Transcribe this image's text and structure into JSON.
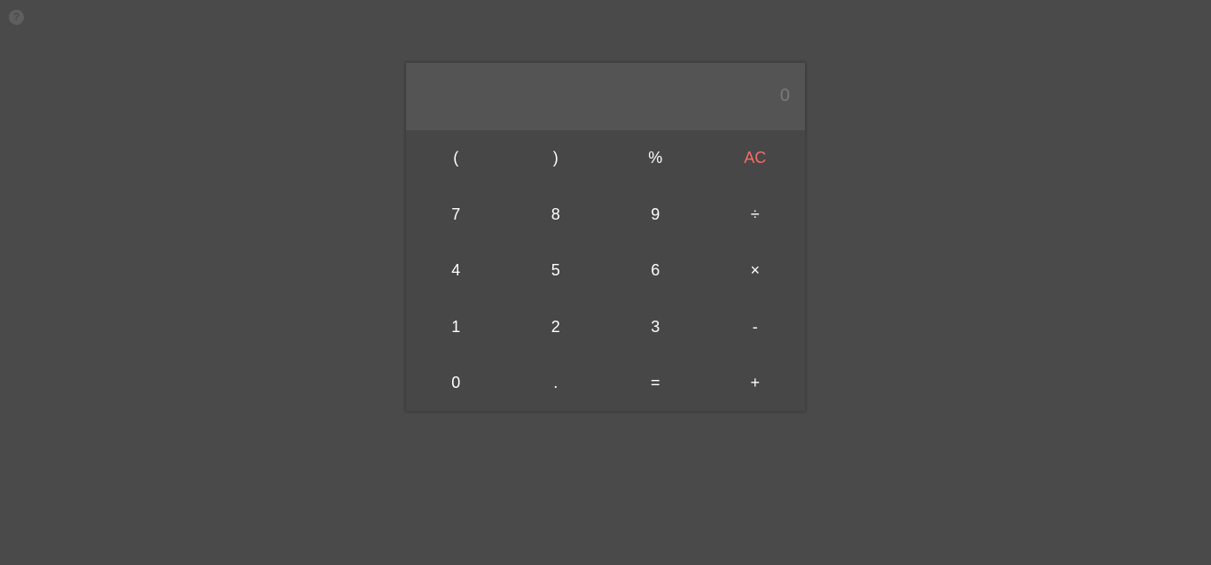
{
  "help": {
    "icon": "question-circle-icon",
    "glyph": "?"
  },
  "display": {
    "value": "0"
  },
  "keys": [
    {
      "label": "(",
      "name": "open-paren-button"
    },
    {
      "label": ")",
      "name": "close-paren-button"
    },
    {
      "label": "%",
      "name": "percent-button"
    },
    {
      "label": "AC",
      "name": "all-clear-button"
    },
    {
      "label": "7",
      "name": "digit-7-button"
    },
    {
      "label": "8",
      "name": "digit-8-button"
    },
    {
      "label": "9",
      "name": "digit-9-button"
    },
    {
      "label": "÷",
      "name": "divide-button"
    },
    {
      "label": "4",
      "name": "digit-4-button"
    },
    {
      "label": "5",
      "name": "digit-5-button"
    },
    {
      "label": "6",
      "name": "digit-6-button"
    },
    {
      "label": "×",
      "name": "multiply-button"
    },
    {
      "label": "1",
      "name": "digit-1-button"
    },
    {
      "label": "2",
      "name": "digit-2-button"
    },
    {
      "label": "3",
      "name": "digit-3-button"
    },
    {
      "label": "-",
      "name": "subtract-button"
    },
    {
      "label": "0",
      "name": "digit-0-button"
    },
    {
      "label": ".",
      "name": "decimal-button"
    },
    {
      "label": "=",
      "name": "equals-button"
    },
    {
      "label": "+",
      "name": "add-button"
    }
  ],
  "colors": {
    "background": "#4a4a4a",
    "display": "#545454",
    "keypad": "#474747",
    "clear_key": "#f36c6a",
    "key_text": "#ffffff"
  }
}
